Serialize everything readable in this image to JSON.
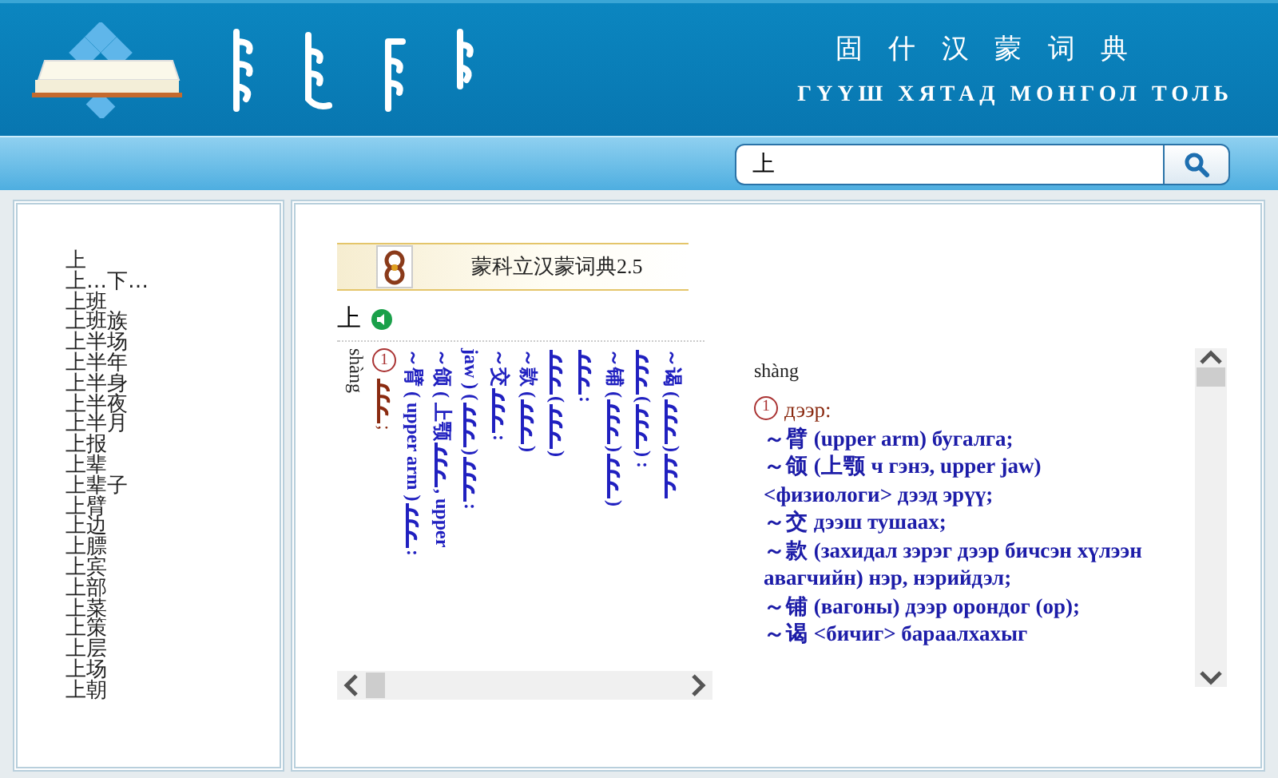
{
  "header": {
    "title_chinese": "固 什 汉 蒙 词 典",
    "title_cyrillic": "ГҮҮШ ХЯТАД МОНГОЛ ТОЛЬ"
  },
  "search": {
    "value": "上"
  },
  "word_list": {
    "items": [
      {
        "text": "上"
      },
      {
        "text": "上…下…"
      },
      {
        "text": "上班"
      },
      {
        "text": "上班族"
      },
      {
        "text": "上半场"
      },
      {
        "text": "上半年"
      },
      {
        "text": "上半身"
      },
      {
        "text": "上半夜"
      },
      {
        "text": "上半月"
      },
      {
        "text": "上报"
      },
      {
        "text": "上辈"
      },
      {
        "text": "上辈子"
      },
      {
        "text": "上臂"
      },
      {
        "text": "上边"
      },
      {
        "text": "上膘"
      },
      {
        "text": "上宾"
      },
      {
        "text": "上部"
      },
      {
        "text": "上菜"
      },
      {
        "text": "上策"
      },
      {
        "text": "上层"
      },
      {
        "text": "上场"
      },
      {
        "text": "上朝"
      }
    ]
  },
  "dictionary": {
    "title": "蒙科立汉蒙词典2.5",
    "headword": "上",
    "vertical_columns": [
      {
        "kind": "pinyin",
        "parts": [
          {
            "kind": "text",
            "text": "shàng"
          }
        ]
      },
      {
        "kind": "sense",
        "parts": [
          {
            "kind": "number",
            "text": "1"
          },
          {
            "kind": "script"
          },
          {
            "kind": "text",
            "text": " ;"
          }
        ]
      },
      {
        "kind": "entry",
        "parts": [
          {
            "kind": "text",
            "text": "～臂 ( upper arm ) "
          },
          {
            "kind": "script"
          },
          {
            "kind": "text",
            "text": " :"
          }
        ]
      },
      {
        "kind": "entry",
        "parts": [
          {
            "kind": "text",
            "text": "～颌 ( 上颚 "
          },
          {
            "kind": "script"
          },
          {
            "kind": "text",
            "text": " , upper"
          }
        ]
      },
      {
        "kind": "entry",
        "parts": [
          {
            "kind": "text",
            "text": "jaw ) ( "
          },
          {
            "kind": "script"
          },
          {
            "kind": "text",
            "text": " ) "
          },
          {
            "kind": "script"
          },
          {
            "kind": "text",
            "text": " :"
          }
        ]
      },
      {
        "kind": "entry",
        "parts": [
          {
            "kind": "text",
            "text": "～交 "
          },
          {
            "kind": "script"
          },
          {
            "kind": "text",
            "text": " :"
          }
        ]
      },
      {
        "kind": "entry",
        "parts": [
          {
            "kind": "text",
            "text": "～款 ( "
          },
          {
            "kind": "script"
          },
          {
            "kind": "text",
            "text": " )"
          }
        ]
      },
      {
        "kind": "entry",
        "parts": [
          {
            "kind": "script"
          },
          {
            "kind": "text",
            "text": " ( "
          },
          {
            "kind": "script"
          },
          {
            "kind": "text",
            "text": " )"
          }
        ]
      },
      {
        "kind": "entry",
        "parts": [
          {
            "kind": "script"
          },
          {
            "kind": "text",
            "text": " :"
          }
        ]
      },
      {
        "kind": "entry",
        "parts": [
          {
            "kind": "text",
            "text": "～铺 ( "
          },
          {
            "kind": "script"
          },
          {
            "kind": "text",
            "text": " ) "
          },
          {
            "kind": "script"
          },
          {
            "kind": "text",
            "text": " )"
          }
        ]
      },
      {
        "kind": "entry",
        "parts": [
          {
            "kind": "script"
          },
          {
            "kind": "text",
            "text": " ( "
          },
          {
            "kind": "script"
          },
          {
            "kind": "text",
            "text": " ) :"
          }
        ]
      },
      {
        "kind": "entry",
        "parts": [
          {
            "kind": "text",
            "text": "～谒 ( "
          },
          {
            "kind": "script"
          },
          {
            "kind": "text",
            "text": " ) "
          },
          {
            "kind": "script"
          }
        ]
      }
    ],
    "pinyin": "shàng",
    "sense_number": "1",
    "sense": "дээр:",
    "lines": [
      {
        "text": "～臂 (upper arm) бугалга;"
      },
      {
        "text": "～颌 (上颚 ч гэнэ, upper jaw) <физиологи> дээд эрүү;"
      },
      {
        "text": "～交 дээш тушаах;"
      },
      {
        "text": "～款 (захидал зэрэг дээр бичсэн хүлээн авагчийн) нэр, нэрийдэл;"
      },
      {
        "text": "～铺 (вагоны) дээр орондог (op);"
      },
      {
        "text": "～谒 <бичиг> бараалхахыг"
      }
    ]
  }
}
